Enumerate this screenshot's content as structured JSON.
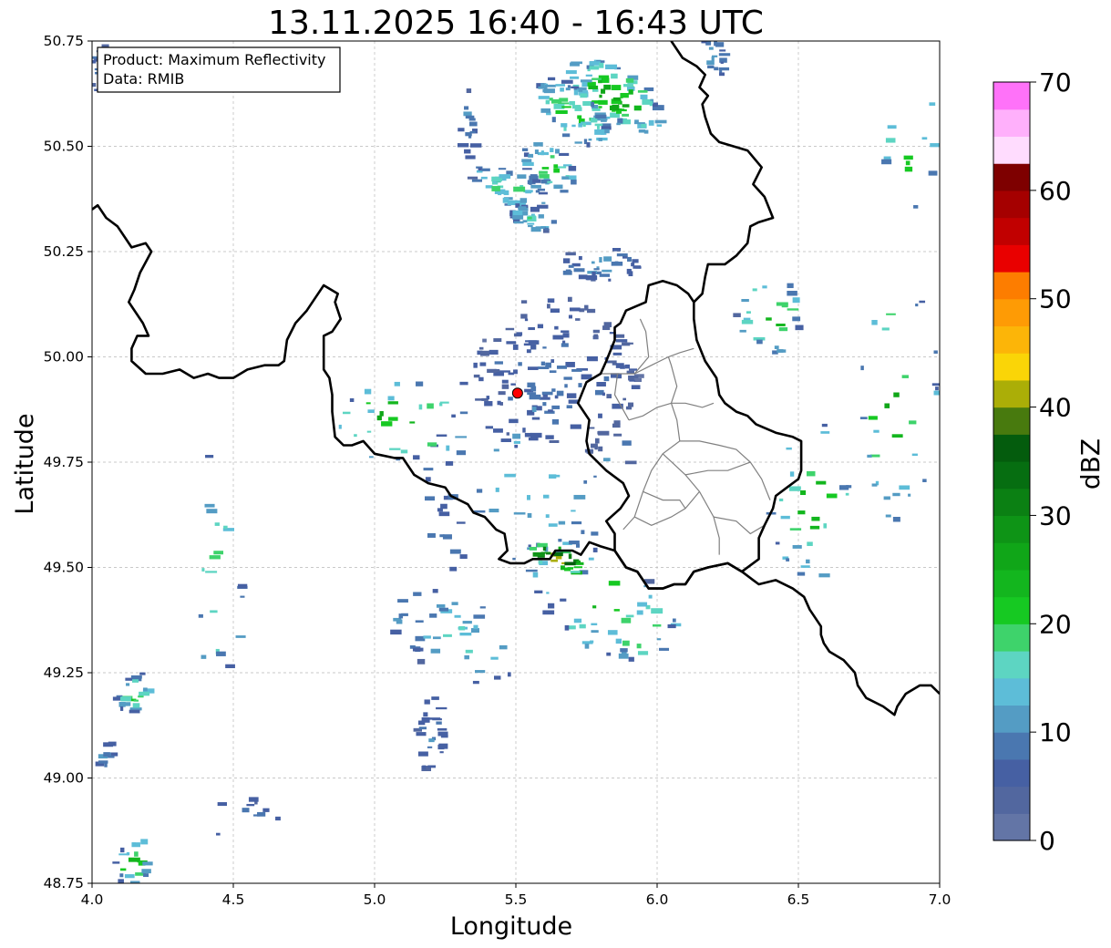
{
  "title": "13.11.2025 16:40 - 16:43 UTC",
  "info_box": {
    "product": "Product: Maximum Reflectivity",
    "data": "Data: RMIB"
  },
  "x_axis": {
    "label": "Longitude",
    "range": [
      4.0,
      7.0
    ],
    "ticks": [
      "4.0",
      "4.5",
      "5.0",
      "5.5",
      "6.0",
      "6.5",
      "7.0"
    ]
  },
  "y_axis": {
    "label": "Latitude",
    "range": [
      48.75,
      50.75
    ],
    "ticks": [
      "48.75",
      "49.00",
      "49.25",
      "49.50",
      "49.75",
      "50.00",
      "50.25",
      "50.50",
      "50.75"
    ]
  },
  "colorbar": {
    "label": "dBZ",
    "range": [
      0,
      70
    ],
    "step": 2.5,
    "ticks": [
      "0",
      "10",
      "20",
      "30",
      "40",
      "50",
      "60",
      "70"
    ],
    "colors": [
      "#6375a6",
      "#52679f",
      "#4660a3",
      "#4a77b0",
      "#549cc4",
      "#5dbdd8",
      "#5dd5c2",
      "#3ed36b",
      "#16c922",
      "#13b61e",
      "#10a618",
      "#0e9416",
      "#0b8013",
      "#066e11",
      "#045c0d",
      "#487a0e",
      "#abae07",
      "#fad507",
      "#fcb508",
      "#fe9b05",
      "#fd7d00",
      "#e90000",
      "#c10000",
      "#a50000",
      "#7e0000",
      "#ffdcfe",
      "#ffb0fb",
      "#ff72f9",
      "#ef35ea"
    ]
  },
  "radar_site": {
    "lon": 5.506,
    "lat": 49.914,
    "color": "#ff0000"
  },
  "grid": true,
  "boundary_color": "#000000",
  "district_color": "#808080",
  "country_border_path": [
    [
      6.05,
      50.75
    ],
    [
      6.09,
      50.71
    ],
    [
      6.14,
      50.69
    ],
    [
      6.17,
      50.67
    ],
    [
      6.15,
      50.64
    ],
    [
      6.18,
      50.62
    ],
    [
      6.16,
      50.6
    ],
    [
      6.17,
      50.57
    ],
    [
      6.19,
      50.53
    ],
    [
      6.22,
      50.51
    ],
    [
      6.27,
      50.5
    ],
    [
      6.32,
      50.49
    ],
    [
      6.37,
      50.45
    ],
    [
      6.34,
      50.41
    ],
    [
      6.38,
      50.38
    ],
    [
      6.41,
      50.33
    ],
    [
      6.36,
      50.32
    ],
    [
      6.33,
      50.31
    ],
    [
      6.32,
      50.27
    ],
    [
      6.28,
      50.24
    ],
    [
      6.24,
      50.22
    ],
    [
      6.18,
      50.22
    ],
    [
      6.17,
      50.19
    ],
    [
      6.16,
      50.15
    ],
    [
      6.13,
      50.13
    ]
  ],
  "france_border_path": [
    [
      4.0,
      50.35
    ],
    [
      4.02,
      50.36
    ],
    [
      4.05,
      50.33
    ],
    [
      4.09,
      50.31
    ],
    [
      4.12,
      50.28
    ],
    [
      4.14,
      50.26
    ],
    [
      4.19,
      50.27
    ],
    [
      4.21,
      50.25
    ],
    [
      4.17,
      50.2
    ],
    [
      4.15,
      50.16
    ],
    [
      4.13,
      50.13
    ],
    [
      4.18,
      50.08
    ],
    [
      4.2,
      50.05
    ],
    [
      4.16,
      50.05
    ],
    [
      4.14,
      50.02
    ],
    [
      4.14,
      49.99
    ],
    [
      4.19,
      49.96
    ],
    [
      4.25,
      49.96
    ],
    [
      4.31,
      49.97
    ],
    [
      4.36,
      49.95
    ],
    [
      4.41,
      49.96
    ],
    [
      4.45,
      49.95
    ],
    [
      4.5,
      49.95
    ],
    [
      4.55,
      49.97
    ],
    [
      4.61,
      49.98
    ],
    [
      4.66,
      49.98
    ],
    [
      4.68,
      49.99
    ],
    [
      4.69,
      50.04
    ],
    [
      4.72,
      50.08
    ],
    [
      4.76,
      50.11
    ],
    [
      4.79,
      50.14
    ],
    [
      4.82,
      50.17
    ],
    [
      4.87,
      50.15
    ],
    [
      4.86,
      50.13
    ],
    [
      4.88,
      50.09
    ],
    [
      4.85,
      50.06
    ],
    [
      4.82,
      50.05
    ],
    [
      4.82,
      49.97
    ],
    [
      4.84,
      49.95
    ],
    [
      4.85,
      49.91
    ],
    [
      4.85,
      49.87
    ],
    [
      4.86,
      49.81
    ],
    [
      4.89,
      49.79
    ],
    [
      4.92,
      49.79
    ],
    [
      4.96,
      49.8
    ],
    [
      5.0,
      49.77
    ],
    [
      5.07,
      49.76
    ],
    [
      5.1,
      49.76
    ],
    [
      5.14,
      49.72
    ],
    [
      5.19,
      49.7
    ],
    [
      5.25,
      49.69
    ],
    [
      5.27,
      49.67
    ],
    [
      5.33,
      49.65
    ],
    [
      5.35,
      49.63
    ],
    [
      5.39,
      49.62
    ],
    [
      5.43,
      49.59
    ],
    [
      5.46,
      49.58
    ],
    [
      5.47,
      49.54
    ],
    [
      5.44,
      49.52
    ],
    [
      5.48,
      49.51
    ],
    [
      5.53,
      49.51
    ],
    [
      5.56,
      49.52
    ],
    [
      5.62,
      49.52
    ],
    [
      5.64,
      49.54
    ],
    [
      5.7,
      49.54
    ],
    [
      5.73,
      49.53
    ],
    [
      5.76,
      49.56
    ],
    [
      5.8,
      49.55
    ],
    [
      5.85,
      49.54
    ],
    [
      5.89,
      49.5
    ],
    [
      5.93,
      49.49
    ],
    [
      5.97,
      49.45
    ],
    [
      6.02,
      49.45
    ],
    [
      6.06,
      49.46
    ],
    [
      6.1,
      49.46
    ],
    [
      6.13,
      49.49
    ],
    [
      6.18,
      49.5
    ],
    [
      6.25,
      49.51
    ],
    [
      6.3,
      49.49
    ],
    [
      6.34,
      49.47
    ],
    [
      6.36,
      49.46
    ],
    [
      6.42,
      49.47
    ],
    [
      6.48,
      49.45
    ],
    [
      6.52,
      49.43
    ],
    [
      6.54,
      49.4
    ],
    [
      6.58,
      49.36
    ],
    [
      6.58,
      49.34
    ],
    [
      6.59,
      49.32
    ],
    [
      6.61,
      49.3
    ],
    [
      6.66,
      49.28
    ],
    [
      6.7,
      49.25
    ],
    [
      6.71,
      49.22
    ],
    [
      6.74,
      49.19
    ],
    [
      6.8,
      49.17
    ],
    [
      6.84,
      49.15
    ],
    [
      6.85,
      49.17
    ],
    [
      6.88,
      49.2
    ],
    [
      6.93,
      49.22
    ],
    [
      6.97,
      49.22
    ],
    [
      7.0,
      49.2
    ]
  ],
  "luxembourg_path": [
    [
      6.13,
      50.13
    ],
    [
      6.11,
      50.15
    ],
    [
      6.07,
      50.17
    ],
    [
      6.02,
      50.18
    ],
    [
      5.97,
      50.17
    ],
    [
      5.96,
      50.13
    ],
    [
      5.89,
      50.11
    ],
    [
      5.87,
      50.08
    ],
    [
      5.85,
      50.07
    ],
    [
      5.85,
      50.04
    ],
    [
      5.82,
      49.99
    ],
    [
      5.8,
      49.96
    ],
    [
      5.75,
      49.94
    ],
    [
      5.72,
      49.89
    ],
    [
      5.76,
      49.85
    ],
    [
      5.75,
      49.8
    ],
    [
      5.76,
      49.77
    ],
    [
      5.82,
      49.73
    ],
    [
      5.88,
      49.7
    ],
    [
      5.9,
      49.67
    ],
    [
      5.87,
      49.64
    ],
    [
      5.82,
      49.61
    ],
    [
      5.85,
      49.58
    ],
    [
      5.85,
      49.54
    ],
    [
      5.89,
      49.5
    ],
    [
      5.93,
      49.49
    ],
    [
      5.97,
      49.45
    ],
    [
      6.02,
      49.45
    ],
    [
      6.06,
      49.46
    ],
    [
      6.1,
      49.46
    ],
    [
      6.13,
      49.49
    ],
    [
      6.18,
      49.5
    ],
    [
      6.25,
      49.51
    ],
    [
      6.3,
      49.49
    ],
    [
      6.36,
      49.52
    ],
    [
      6.36,
      49.57
    ],
    [
      6.38,
      49.6
    ],
    [
      6.41,
      49.64
    ],
    [
      6.42,
      49.67
    ],
    [
      6.46,
      49.69
    ],
    [
      6.5,
      49.71
    ],
    [
      6.51,
      49.73
    ],
    [
      6.51,
      49.77
    ],
    [
      6.51,
      49.8
    ],
    [
      6.48,
      49.81
    ],
    [
      6.42,
      49.82
    ],
    [
      6.35,
      49.84
    ],
    [
      6.32,
      49.86
    ],
    [
      6.28,
      49.87
    ],
    [
      6.24,
      49.89
    ],
    [
      6.22,
      49.91
    ],
    [
      6.21,
      49.95
    ],
    [
      6.17,
      49.99
    ],
    [
      6.14,
      50.04
    ],
    [
      6.13,
      50.09
    ],
    [
      6.13,
      50.13
    ]
  ],
  "district_lines": [
    [
      [
        5.9,
        49.85
      ],
      [
        5.95,
        49.86
      ],
      [
        6.0,
        49.88
      ],
      [
        6.05,
        49.89
      ],
      [
        6.1,
        49.89
      ],
      [
        6.16,
        49.88
      ],
      [
        6.2,
        49.89
      ]
    ],
    [
      [
        6.05,
        49.89
      ],
      [
        6.07,
        49.85
      ],
      [
        6.08,
        49.8
      ],
      [
        6.02,
        49.77
      ],
      [
        5.98,
        49.73
      ],
      [
        5.95,
        49.68
      ],
      [
        5.92,
        49.62
      ],
      [
        5.88,
        49.59
      ]
    ],
    [
      [
        6.08,
        49.8
      ],
      [
        6.15,
        49.8
      ],
      [
        6.22,
        49.79
      ],
      [
        6.28,
        49.78
      ],
      [
        6.33,
        49.75
      ],
      [
        6.37,
        49.71
      ],
      [
        6.4,
        49.66
      ]
    ],
    [
      [
        6.02,
        49.77
      ],
      [
        6.1,
        49.72
      ],
      [
        6.15,
        49.68
      ],
      [
        6.2,
        49.62
      ],
      [
        6.22,
        49.57
      ],
      [
        6.22,
        49.53
      ]
    ],
    [
      [
        6.1,
        49.72
      ],
      [
        6.18,
        49.73
      ],
      [
        6.25,
        49.73
      ],
      [
        6.33,
        49.75
      ]
    ],
    [
      [
        6.15,
        49.68
      ],
      [
        6.1,
        49.64
      ],
      [
        6.05,
        49.62
      ],
      [
        5.98,
        49.6
      ],
      [
        5.92,
        49.62
      ]
    ],
    [
      [
        6.2,
        49.62
      ],
      [
        6.28,
        49.61
      ],
      [
        6.33,
        49.58
      ],
      [
        6.38,
        49.6
      ]
    ],
    [
      [
        5.95,
        49.68
      ],
      [
        6.02,
        49.66
      ],
      [
        6.08,
        49.66
      ],
      [
        6.1,
        49.64
      ]
    ],
    [
      [
        5.8,
        49.96
      ],
      [
        5.86,
        49.96
      ],
      [
        5.92,
        49.96
      ],
      [
        5.98,
        49.98
      ],
      [
        6.04,
        50.0
      ],
      [
        6.08,
        50.01
      ],
      [
        6.13,
        50.02
      ]
    ],
    [
      [
        5.86,
        49.96
      ],
      [
        5.85,
        49.91
      ],
      [
        5.9,
        49.85
      ]
    ],
    [
      [
        5.92,
        49.96
      ],
      [
        5.97,
        50.0
      ],
      [
        5.96,
        50.06
      ],
      [
        5.94,
        50.09
      ]
    ],
    [
      [
        6.05,
        49.89
      ],
      [
        6.07,
        49.93
      ],
      [
        6.05,
        49.98
      ],
      [
        6.04,
        50.0
      ]
    ]
  ],
  "echo_clusters": [
    {
      "lon": 5.85,
      "lat": 50.62,
      "rx": 0.18,
      "ry": 0.07,
      "rot": -18,
      "n": 95,
      "dbz": [
        4,
        26
      ]
    },
    {
      "lon": 5.7,
      "lat": 50.58,
      "rx": 0.14,
      "ry": 0.06,
      "rot": -25,
      "n": 60,
      "dbz": [
        4,
        22
      ]
    },
    {
      "lon": 5.48,
      "lat": 50.4,
      "rx": 0.14,
      "ry": 0.04,
      "rot": -15,
      "n": 45,
      "dbz": [
        4,
        20
      ]
    },
    {
      "lon": 5.62,
      "lat": 50.45,
      "rx": 0.1,
      "ry": 0.05,
      "rot": -20,
      "n": 35,
      "dbz": [
        4,
        22
      ]
    },
    {
      "lon": 5.56,
      "lat": 50.33,
      "rx": 0.08,
      "ry": 0.03,
      "rot": -10,
      "n": 25,
      "dbz": [
        4,
        18
      ]
    },
    {
      "lon": 5.33,
      "lat": 50.55,
      "rx": 0.04,
      "ry": 0.09,
      "rot": 10,
      "n": 15,
      "dbz": [
        4,
        10
      ]
    },
    {
      "lon": 6.2,
      "lat": 50.71,
      "rx": 0.06,
      "ry": 0.04,
      "rot": -30,
      "n": 18,
      "dbz": [
        4,
        12
      ]
    },
    {
      "lon": 5.64,
      "lat": 49.95,
      "rx": 0.3,
      "ry": 0.2,
      "rot": 0,
      "n": 150,
      "dbz": [
        2,
        9
      ]
    },
    {
      "lon": 5.8,
      "lat": 50.22,
      "rx": 0.14,
      "ry": 0.04,
      "rot": 0,
      "n": 35,
      "dbz": [
        4,
        12
      ]
    },
    {
      "lon": 5.55,
      "lat": 49.7,
      "rx": 0.4,
      "ry": 0.3,
      "rot": 0,
      "n": 70,
      "dbz": [
        4,
        14
      ]
    },
    {
      "lon": 5.8,
      "lat": 49.42,
      "rx": 0.3,
      "ry": 0.12,
      "rot": -20,
      "n": 50,
      "dbz": [
        4,
        24
      ]
    },
    {
      "lon": 5.3,
      "lat": 49.33,
      "rx": 0.25,
      "ry": 0.1,
      "rot": -15,
      "n": 40,
      "dbz": [
        4,
        16
      ]
    },
    {
      "lon": 5.65,
      "lat": 49.52,
      "rx": 0.1,
      "ry": 0.03,
      "rot": -10,
      "n": 25,
      "dbz": [
        10,
        42
      ]
    },
    {
      "lon": 4.15,
      "lat": 49.2,
      "rx": 0.07,
      "ry": 0.04,
      "rot": 30,
      "n": 25,
      "dbz": [
        4,
        20
      ]
    },
    {
      "lon": 4.15,
      "lat": 48.8,
      "rx": 0.08,
      "ry": 0.05,
      "rot": 30,
      "n": 22,
      "dbz": [
        4,
        24
      ]
    },
    {
      "lon": 4.05,
      "lat": 49.05,
      "rx": 0.04,
      "ry": 0.04,
      "rot": 30,
      "n": 10,
      "dbz": [
        4,
        10
      ]
    },
    {
      "lon": 4.05,
      "lat": 50.68,
      "rx": 0.06,
      "ry": 0.06,
      "rot": 0,
      "n": 22,
      "dbz": [
        4,
        10
      ]
    },
    {
      "lon": 6.85,
      "lat": 49.9,
      "rx": 0.15,
      "ry": 0.3,
      "rot": 0,
      "n": 30,
      "dbz": [
        4,
        26
      ]
    },
    {
      "lon": 6.55,
      "lat": 49.65,
      "rx": 0.15,
      "ry": 0.2,
      "rot": 0,
      "n": 30,
      "dbz": [
        4,
        24
      ]
    },
    {
      "lon": 6.4,
      "lat": 50.1,
      "rx": 0.12,
      "ry": 0.1,
      "rot": 0,
      "n": 25,
      "dbz": [
        4,
        24
      ]
    },
    {
      "lon": 5.1,
      "lat": 49.85,
      "rx": 0.25,
      "ry": 0.1,
      "rot": 0,
      "n": 30,
      "dbz": [
        4,
        26
      ]
    },
    {
      "lon": 5.2,
      "lat": 49.1,
      "rx": 0.05,
      "ry": 0.1,
      "rot": 0,
      "n": 25,
      "dbz": [
        4,
        10
      ]
    },
    {
      "lon": 4.55,
      "lat": 48.9,
      "rx": 0.15,
      "ry": 0.05,
      "rot": 0,
      "n": 10,
      "dbz": [
        4,
        10
      ]
    },
    {
      "lon": 4.45,
      "lat": 49.5,
      "rx": 0.1,
      "ry": 0.3,
      "rot": 0,
      "n": 20,
      "dbz": [
        4,
        20
      ]
    },
    {
      "lon": 6.9,
      "lat": 50.5,
      "rx": 0.1,
      "ry": 0.15,
      "rot": 0,
      "n": 12,
      "dbz": [
        4,
        26
      ]
    }
  ]
}
